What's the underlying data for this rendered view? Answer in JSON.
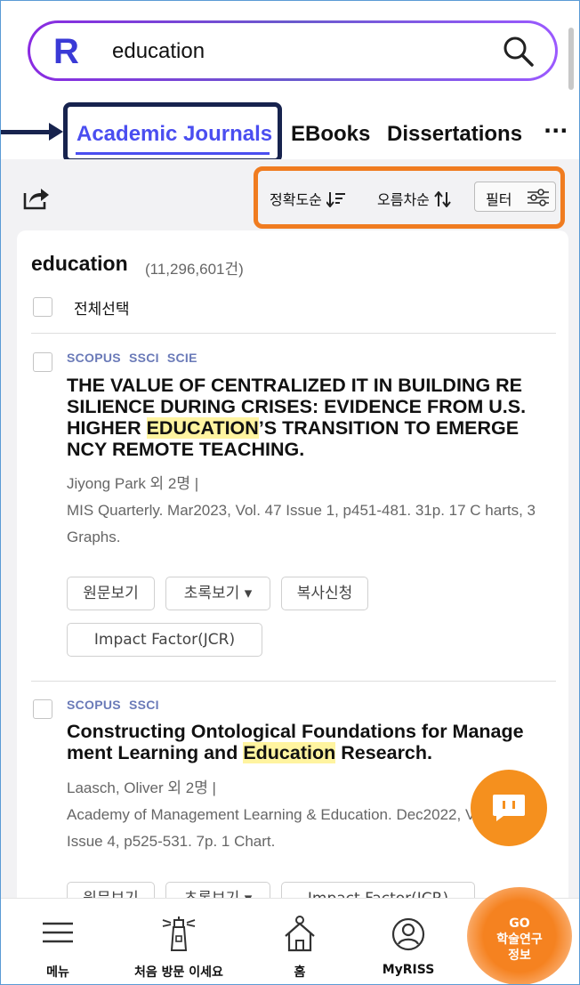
{
  "search": {
    "logo": "R",
    "query": "education"
  },
  "tabs": {
    "items": [
      {
        "label": "Academic Journals"
      },
      {
        "label": "EBooks"
      },
      {
        "label": "Dissertations"
      }
    ],
    "more": "···"
  },
  "toolbar": {
    "sort_accuracy": "정확도순",
    "sort_order": "오름차순",
    "filter": "필터"
  },
  "results": {
    "query": "education",
    "count": "(11,296,601건)",
    "select_all": "전체선택",
    "items": [
      {
        "badges": [
          "SCOPUS",
          "SSCI",
          "SCIE"
        ],
        "title_before": "THE VALUE OF CENTRALIZED IT IN BUILDING RE SILIENCE DURING CRISES: EVIDENCE FROM U.S. HIGHER ",
        "title_highlight": "EDUCATION",
        "title_after": "’S TRANSITION TO EMERGE NCY REMOTE TEACHING.",
        "authors": "Jiyong Park 외 2명 |",
        "source": "MIS Quarterly. Mar2023, Vol. 47 Issue 1, p451-481. 31p. 17 C harts, 3 Graphs.",
        "buttons": [
          "원문보기",
          "초록보기 ▾",
          "복사신청"
        ],
        "button_extra": "Impact Factor(JCR)"
      },
      {
        "badges": [
          "SCOPUS",
          "SSCI"
        ],
        "title_before": "Constructing Ontological Foundations for Manage ment Learning and ",
        "title_highlight": "Education",
        "title_after": " Research.",
        "authors": "Laasch, Oliver 외 2명 |",
        "source": "Academy of Management Learning & Education. Dec2022, V ol. 21 Issue 4, p525-531. 7p. 1 Chart.",
        "buttons": [
          "원문보기",
          "초록보기 ▾",
          "Impact Factor(JCR)"
        ]
      }
    ]
  },
  "bottom_nav": {
    "menu": "메뉴",
    "first_visit": "처음 방문 이세요",
    "home": "홈",
    "myriss": "MyRISS",
    "go_line1": "GO",
    "go_line2": "학술연구",
    "go_line3": "정보"
  },
  "colors": {
    "accent": "#4a4ef0",
    "highlight_dark": "#17234e",
    "highlight_orange": "#f07c20",
    "fab": "#f5901e"
  }
}
